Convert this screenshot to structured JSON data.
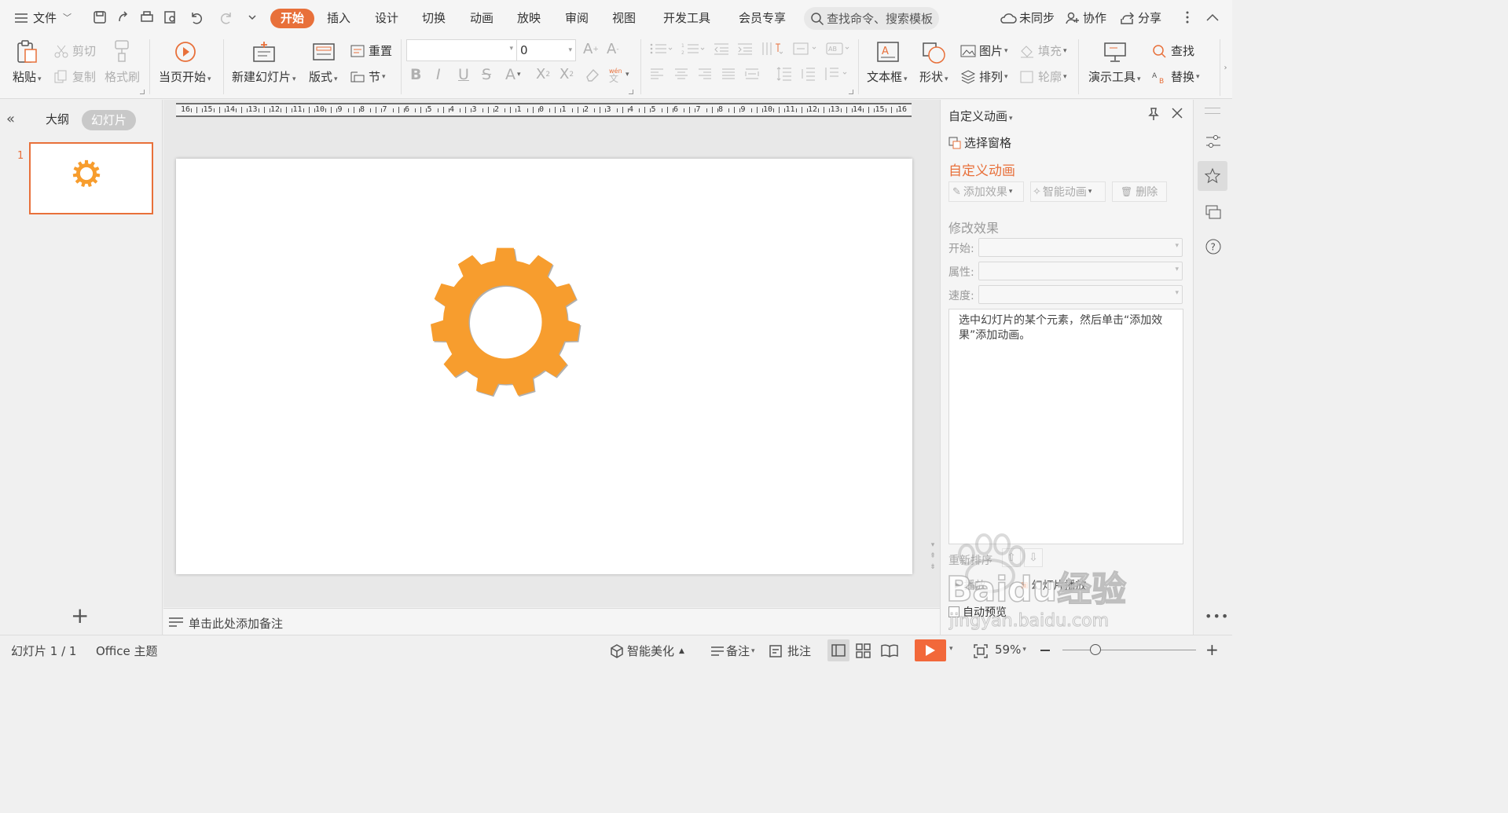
{
  "colors": {
    "accent": "#e8703a",
    "gear": "#f79d2e",
    "active_tab_bg": "#e8703a"
  },
  "topbar": {
    "file_menu": "文件",
    "tabs": [
      "开始",
      "插入",
      "设计",
      "切换",
      "动画",
      "放映",
      "审阅",
      "视图",
      "开发工具",
      "会员专享"
    ],
    "active_tab": "开始",
    "search_placeholder": "查找命令、搜索模板",
    "sync": "未同步",
    "collab": "协作",
    "share": "分享"
  },
  "ribbon": {
    "paste": "粘贴",
    "cut": "剪切",
    "copy": "复制",
    "format_painter": "格式刷",
    "start_from_current": "当页开始",
    "new_slide": "新建幻灯片",
    "layout": "版式",
    "reset": "重置",
    "section": "节",
    "font_name": "",
    "font_size": "0",
    "textbox": "文本框",
    "shape": "形状",
    "picture": "图片",
    "fill": "填充",
    "arrange": "排列",
    "outline": "轮廓",
    "presentation_tools": "演示工具",
    "find": "查找",
    "replace": "替换"
  },
  "left_panel": {
    "tab_outline": "大纲",
    "tab_slides": "幻灯片",
    "active": "幻灯片",
    "slide_number": "1"
  },
  "notes": {
    "placeholder": "单击此处添加备注"
  },
  "ruler": {
    "labels": [
      "16",
      "15",
      "14",
      "13",
      "12",
      "11",
      "10",
      "9",
      "8",
      "7",
      "6",
      "5",
      "4",
      "3",
      "2",
      "1",
      "0",
      "1",
      "2",
      "3",
      "4",
      "5",
      "6",
      "7",
      "8",
      "9",
      "10",
      "11",
      "12",
      "13",
      "14",
      "15",
      "16"
    ]
  },
  "right_panel": {
    "title": "自定义动画",
    "selection_pane": "选择窗格",
    "section_title": "自定义动画",
    "add_effect": "添加效果",
    "smart_animation": "智能动画",
    "delete": "删除",
    "modify_effect": "修改效果",
    "start_label": "开始:",
    "property_label": "属性:",
    "speed_label": "速度:",
    "hint": "选中幻灯片的某个元素，然后单击“添加效果”添加动画。",
    "reorder": "重新排序",
    "play": "播放",
    "slideshow": "幻灯片播放",
    "auto_preview": "自动预览"
  },
  "statusbar": {
    "slide_info": "幻灯片 1 / 1",
    "theme": "Office 主题",
    "smart_beautify": "智能美化",
    "notes": "备注",
    "comments": "批注",
    "zoom": "59%",
    "zoom_level": 0.59
  },
  "watermark": {
    "text": "Baidu经验",
    "url": "jingyan.baidu.com"
  }
}
